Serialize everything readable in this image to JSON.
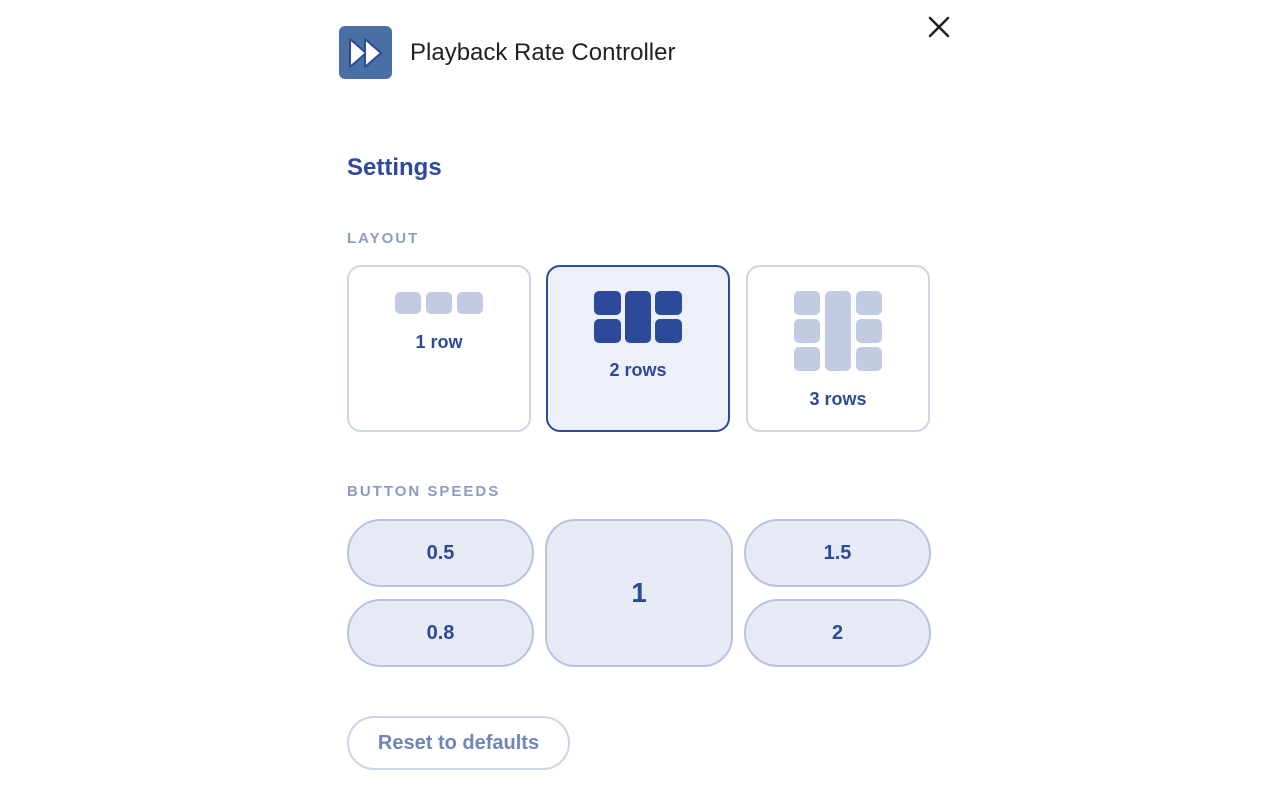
{
  "header": {
    "app_icon": "fast-forward-icon",
    "title": "Playback Rate Controller",
    "close_icon": "close-icon"
  },
  "settings": {
    "title": "Settings",
    "layout_label": "LAYOUT",
    "layout_options": [
      {
        "label": "1 row",
        "selected": false
      },
      {
        "label": "2 rows",
        "selected": true
      },
      {
        "label": "3 rows",
        "selected": false
      }
    ],
    "speeds_label": "BUTTON SPEEDS",
    "speeds": [
      "0.5",
      "0.8",
      "1",
      "1.5",
      "2"
    ],
    "reset_label": "Reset to defaults"
  },
  "colors": {
    "accent": "#2d4a9a",
    "light_accent": "#c3cbe2",
    "button_fill": "#e6eaf4",
    "section_label": "#8a9dc4",
    "app_icon_bg": "#4a6fa5"
  }
}
